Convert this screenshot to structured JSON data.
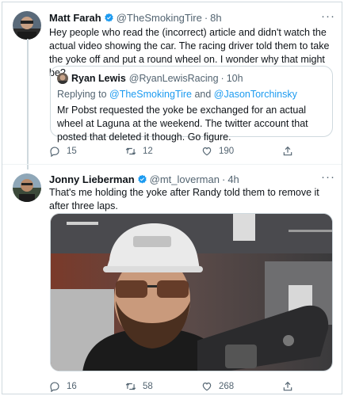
{
  "tweets": [
    {
      "author_name": "Matt Farah",
      "handle": "@TheSmokingTire",
      "time": "8h",
      "text": "Hey people who read the (incorrect) article and didn't watch the actual video showing the car. The racing driver told them to take the yoke off and put a round wheel on.  I wonder why that might be?",
      "verified": true,
      "quote": {
        "author_name": "Ryan Lewis",
        "handle": "@RyanLewisRacing",
        "time": "10h",
        "replying_label": "Replying to",
        "replying_to": "@TheSmokingTire and @JasonTorchinsky",
        "reply_user_a": "@TheSmokingTire",
        "reply_and": "and",
        "reply_user_b": "@JasonTorchinsky",
        "text": "Mr Pobst requested the yoke be exchanged for an actual wheel at Laguna at the weekend. The twitter account that posted that deleted it though. Go figure."
      },
      "actions": {
        "replies": "15",
        "retweets": "12",
        "likes": "190"
      }
    },
    {
      "author_name": "Jonny Lieberman",
      "handle": "@mt_loverman",
      "time": "4h",
      "text": "That's me holding the yoke after Randy told them to remove it after three laps.",
      "verified": true,
      "actions": {
        "replies": "16",
        "retweets": "58",
        "likes": "268"
      }
    }
  ],
  "colors": {
    "verified": "#1d9bf0",
    "link": "#1d9bf0",
    "secondary_text": "#536471",
    "border": "#cfd9de"
  },
  "icons": [
    "verified-badge-icon",
    "more-icon",
    "reply-icon",
    "retweet-icon",
    "like-icon",
    "share-icon"
  ]
}
